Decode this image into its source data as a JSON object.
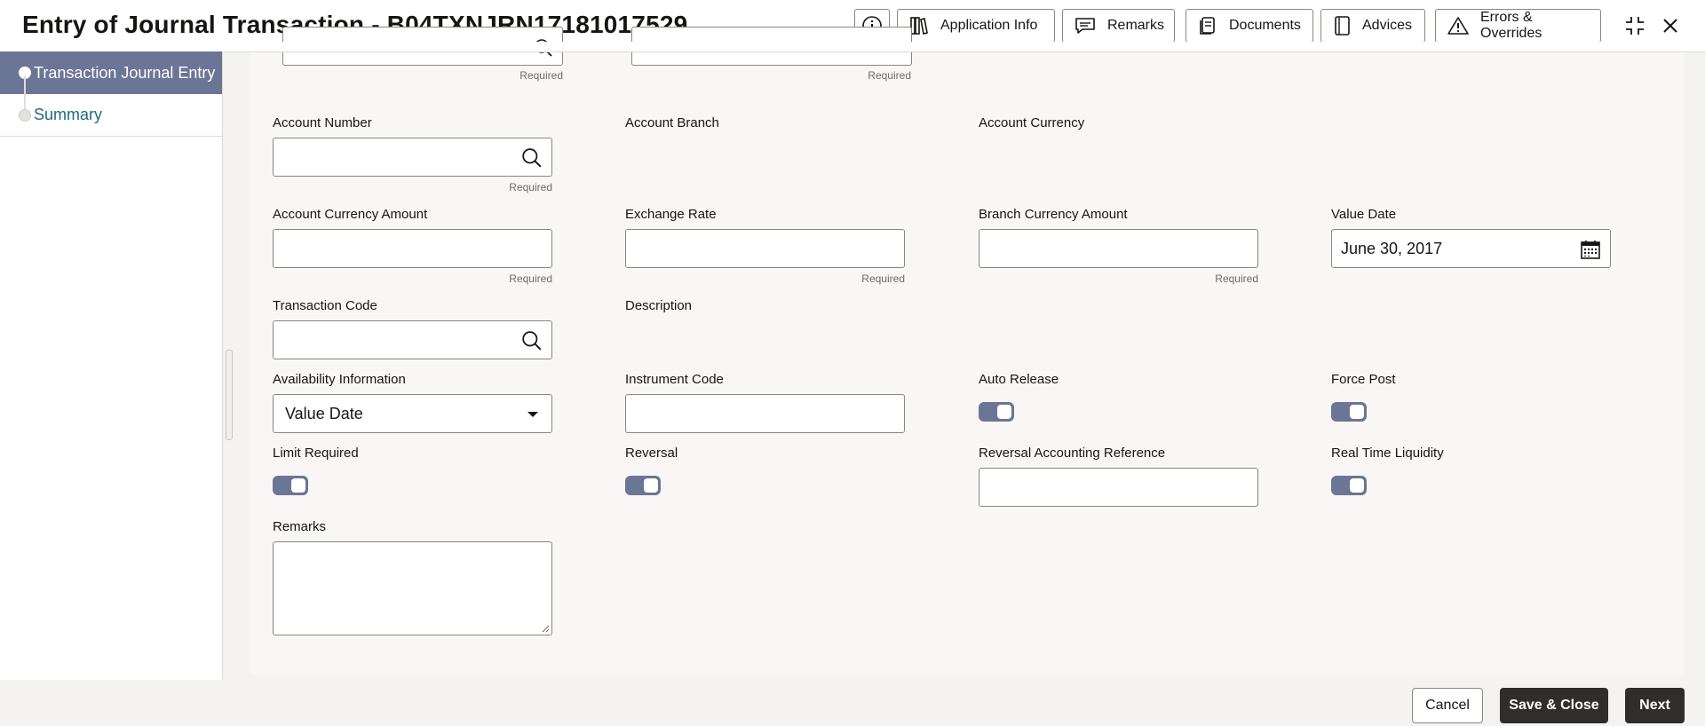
{
  "header": {
    "title": "Entry of Journal Transaction - B04TXNJRN17181017529",
    "buttons": {
      "application_info": "Application Info",
      "remarks": "Remarks",
      "documents": "Documents",
      "advices": "Advices",
      "errors_overrides": "Errors & Overrides"
    }
  },
  "sidebar": {
    "steps": [
      {
        "label": "Transaction Journal Entry",
        "active": true
      },
      {
        "label": "Summary",
        "active": false
      }
    ]
  },
  "form": {
    "required_text": "Required",
    "account_number": {
      "label": "Account Number",
      "value": ""
    },
    "account_branch": {
      "label": "Account Branch",
      "value": ""
    },
    "account_currency": {
      "label": "Account Currency",
      "value": ""
    },
    "account_currency_amount": {
      "label": "Account Currency Amount",
      "value": ""
    },
    "exchange_rate": {
      "label": "Exchange Rate",
      "value": ""
    },
    "branch_currency_amount": {
      "label": "Branch Currency Amount",
      "value": ""
    },
    "value_date": {
      "label": "Value Date",
      "value": "June 30, 2017"
    },
    "transaction_code": {
      "label": "Transaction Code",
      "value": ""
    },
    "description": {
      "label": "Description",
      "value": ""
    },
    "availability_information": {
      "label": "Availability Information",
      "value": "Value Date"
    },
    "instrument_code": {
      "label": "Instrument Code",
      "value": ""
    },
    "auto_release": {
      "label": "Auto Release",
      "on": true
    },
    "force_post": {
      "label": "Force Post",
      "on": true
    },
    "limit_required": {
      "label": "Limit Required",
      "on": true
    },
    "reversal": {
      "label": "Reversal",
      "on": true
    },
    "reversal_accounting_reference": {
      "label": "Reversal Accounting Reference",
      "value": ""
    },
    "real_time_liquidity": {
      "label": "Real Time Liquidity",
      "on": true
    },
    "remarks": {
      "label": "Remarks",
      "value": ""
    }
  },
  "footer": {
    "cancel": "Cancel",
    "save_close": "Save & Close",
    "next": "Next"
  },
  "colors": {
    "accent": "#6b7596",
    "link": "#1f6a82",
    "primary_button": "#312d2a"
  }
}
